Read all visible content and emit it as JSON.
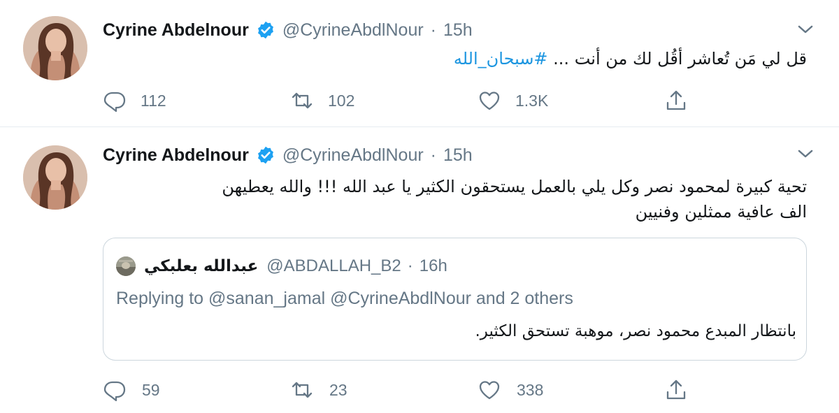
{
  "tweets": [
    {
      "author": {
        "name": "Cyrine Abdelnour",
        "handle": "@CyrineAbdlNour",
        "verified": true
      },
      "time": "15h",
      "text_main": "قل لي مَن تُعاشر أقُل لك من أنت ... ",
      "hashtag": "#سبحان_الله",
      "stats": {
        "replies": "112",
        "retweets": "102",
        "likes": "1.3K"
      }
    },
    {
      "author": {
        "name": "Cyrine Abdelnour",
        "handle": "@CyrineAbdlNour",
        "verified": true
      },
      "time": "15h",
      "text_line1": "تحية كبيرة لمحمود نصر وكل يلي بالعمل يستحقون الكثير يا عبد الله !!! والله يعطيهن",
      "text_line2": "الف عافية ممثلين وفنيين",
      "quoted": {
        "name": "عبدالله بعلبكي",
        "handle": "@ABDALLAH_B2",
        "time": "16h",
        "replying_to": "Replying to @sanan_jamal @CyrineAbdlNour and 2 others",
        "text": "بانتظار المبدع محمود نصر، موهبة تستحق الكثير."
      },
      "stats": {
        "replies": "59",
        "retweets": "23",
        "likes": "338"
      }
    }
  ],
  "separator": "·",
  "icons": {
    "verified": "verified-badge-icon",
    "more": "chevron-down-icon",
    "reply": "reply-icon",
    "retweet": "retweet-icon",
    "like": "heart-icon",
    "share": "share-icon"
  },
  "colors": {
    "link": "#1b95e0",
    "verified": "#1da1f2",
    "secondary_text": "#657786",
    "border": "#e6ecf0"
  }
}
